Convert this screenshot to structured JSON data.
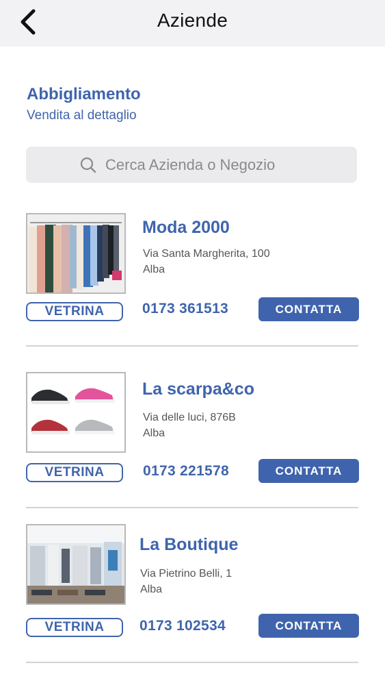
{
  "header": {
    "title": "Aziende",
    "back_icon": "chevron-left-icon"
  },
  "category": {
    "title": "Abbigliamento",
    "subtitle": "Vendita al dettaglio"
  },
  "search": {
    "placeholder": "Cerca Azienda o Negozio",
    "icon": "search-icon"
  },
  "businesses": [
    {
      "name": "Moda 2000",
      "address": "Via Santa Margherita, 100",
      "city": "Alba",
      "phone": "0173 361513",
      "showcase_label": "VETRINA",
      "contact_label": "CONTATTA",
      "image": "clothes-rack-image"
    },
    {
      "name": "La scarpa&co",
      "address": "Via delle luci, 876B",
      "city": "Alba",
      "phone": "0173 221578",
      "showcase_label": "VETRINA",
      "contact_label": "CONTATTA",
      "image": "sneakers-image"
    },
    {
      "name": "La Boutique",
      "address": "Via Pietrino Belli, 1",
      "city": "Alba",
      "phone": "0173 102534",
      "showcase_label": "VETRINA",
      "contact_label": "CONTATTA",
      "image": "boutique-interior-image"
    }
  ],
  "colors": {
    "accent": "#3f64ad",
    "navbar_bg": "#f2f2f4",
    "search_bg": "#ebebed",
    "divider": "#d3d3d3"
  }
}
